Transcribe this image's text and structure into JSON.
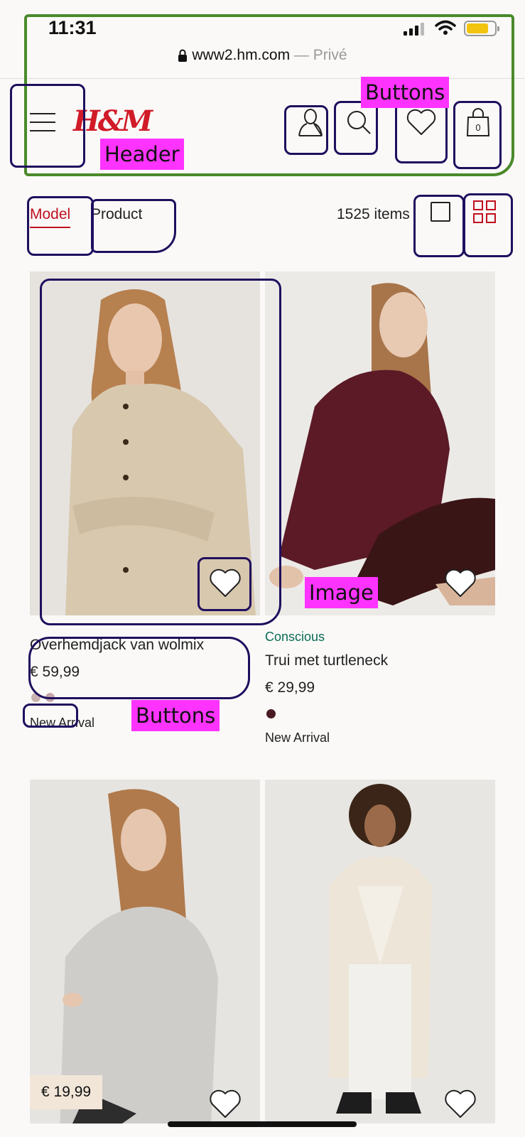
{
  "status": {
    "time": "11:31"
  },
  "browser": {
    "url": "www2.hm.com",
    "separator": " — ",
    "mode": "Privé"
  },
  "header": {
    "logo": "H&M",
    "icons": [
      "menu-icon",
      "account-icon",
      "search-icon",
      "favorites-icon",
      "bag-icon"
    ],
    "bag_count": "0"
  },
  "toolbar": {
    "tab_model": "Model",
    "tab_product": "Product",
    "item_count": "1525 items"
  },
  "products": [
    {
      "tag": "",
      "title": "Overhemdjack van wolmix",
      "price": "€ 59,99",
      "badge": "New Arrival",
      "swatches": [
        "#c9b3b1",
        "#c7a8a8"
      ]
    },
    {
      "tag": "Conscious",
      "title": "Trui met turtleneck",
      "price": "€ 29,99",
      "badge": "New Arrival",
      "swatches": [
        "#4a1a22"
      ]
    },
    {
      "price_tag": "€ 19,99"
    },
    {}
  ],
  "annotations": {
    "header": "Header",
    "buttons_top": "Buttons",
    "image": "Image",
    "buttons_bottom": "Buttons"
  },
  "colors": {
    "brand_red": "#d11b28",
    "active_tab": "#c0101e",
    "conscious_green": "#0b6b55",
    "annotation_tag": "#ff33ff"
  }
}
